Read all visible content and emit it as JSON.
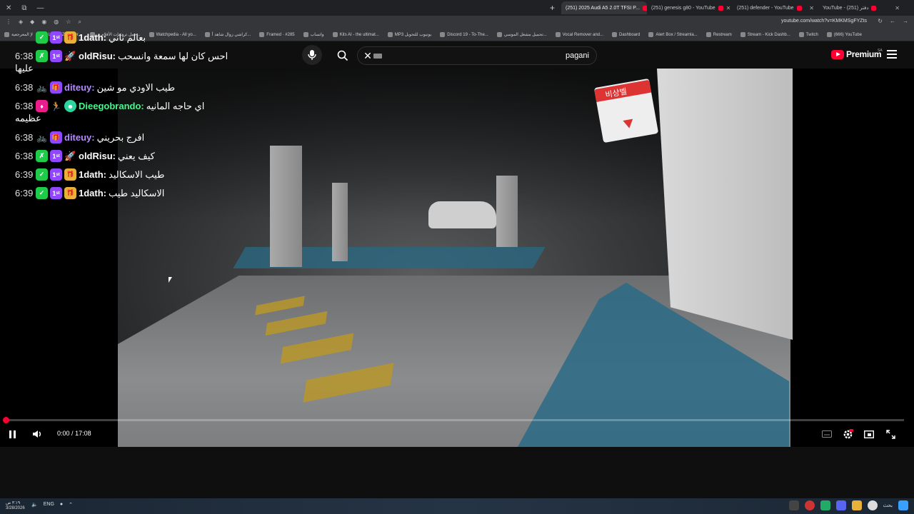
{
  "browser": {
    "tabs": [
      {
        "label": "(251) 2025 Audi A5 2.0T TFSI P...",
        "active": true
      },
      {
        "label": "(251) genesis g80 - YouTube",
        "active": false
      },
      {
        "label": "(251) defender - YouTube",
        "active": false
      },
      {
        "label": "YouTube - (251) دفتر",
        "active": false
      }
    ],
    "new_tab": "+",
    "url": "youtube.com/watch?v=KMKMSgFYZts",
    "bookmarks": [
      "لإ المعرجعية",
      "Lord AIZiat Stor...",
      "حمل ترجمات الأفلام م...",
      "Watchpedia - All yo...",
      "كراشي زوال شاهد أ...",
      "Framed · #285",
      "واتساب",
      "Kits AI - the ultimat...",
      "MP3 يوتيوب للتحويل",
      "Discord 19 - To-The...",
      "تحميل مشغل الموسي...",
      "Vocal Remover and...",
      "Dashboard",
      "Alert Box / Streamla...",
      "Restream",
      "Stream - Kick Dashb...",
      "Twitch",
      "(666) YouTube"
    ]
  },
  "youtube": {
    "search_query": "pagani",
    "brand": "Premium",
    "region": "SA",
    "accent": "#ff0033"
  },
  "chat": [
    {
      "time": "",
      "user": "1dath:",
      "message": "بعالم ثاني",
      "partial": true
    },
    {
      "time": "6:38",
      "user": "oldRisu:",
      "message": "احس كان لها سمعة وانسحب",
      "wrap": "عليها"
    },
    {
      "time": "6:38",
      "user": "diteuy:",
      "message": "طيب الاودي مو شين"
    },
    {
      "time": "6:38",
      "user": "Dieegobrando:",
      "message": "اي حاجه المانيه",
      "wrap": "عظيمه"
    },
    {
      "time": "6:38",
      "user": "diteuy:",
      "message": "افرج بحريني"
    },
    {
      "time": "6:38",
      "user": "oldRisu:",
      "message": "كيف يعني"
    },
    {
      "time": "6:39",
      "user": "1dath:",
      "message": "طيب الاسكاليد"
    },
    {
      "time": "6:39",
      "user": "1dath:",
      "message": "الاسكاليد طيب"
    }
  ],
  "player": {
    "current_time": "0:00",
    "separator": "/",
    "duration": "17:08",
    "progress": 0.0
  },
  "video_signs": {
    "sign_text": "비상벨"
  },
  "taskbar": {
    "time": "٣:١٩ ص",
    "date": "3/28/2026",
    "lang": "ENG",
    "search_label": "بحث"
  }
}
